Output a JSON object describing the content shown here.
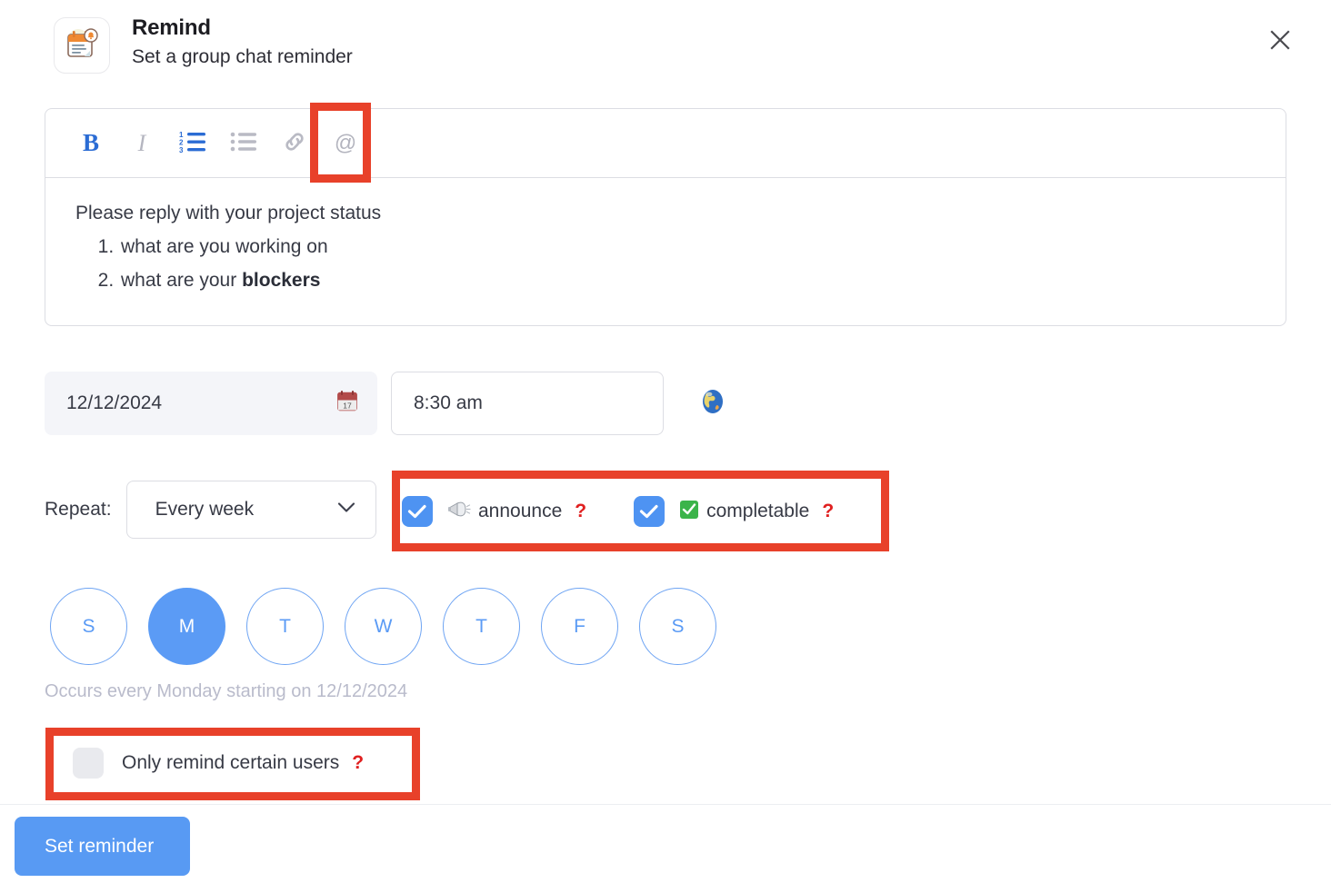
{
  "header": {
    "icon": "reminder-calendar-icon",
    "title": "Remind",
    "subtitle": "Set a group chat reminder",
    "close_label": "close-icon"
  },
  "editor": {
    "toolbar": [
      {
        "name": "bold",
        "glyph": "B",
        "active": true
      },
      {
        "name": "italic",
        "glyph": "I",
        "active": false
      },
      {
        "name": "ordered-list",
        "glyph": "ordered-list-icon",
        "active": true
      },
      {
        "name": "bullet-list",
        "glyph": "bullet-list-icon",
        "active": false
      },
      {
        "name": "link",
        "glyph": "link-icon",
        "active": false
      },
      {
        "name": "mention",
        "glyph": "@",
        "active": false
      }
    ],
    "content": {
      "paragraph": "Please reply with your project status",
      "list": [
        {
          "text": "what are you working on",
          "bold_suffix": ""
        },
        {
          "text": "what are your ",
          "bold_suffix": "blockers"
        }
      ]
    }
  },
  "schedule": {
    "date_value": "12/12/2024",
    "date_icon": "calendar-icon",
    "time_value": "8:30 am",
    "timezone_icon": "globe-icon"
  },
  "repeat": {
    "label": "Repeat:",
    "selected": "Every week",
    "chevron": "chevron-down-icon"
  },
  "options": [
    {
      "name": "announce",
      "emoji": "megaphone-icon",
      "label": "announce",
      "checked": true,
      "help": "?"
    },
    {
      "name": "completable",
      "emoji": "green-check-icon",
      "label": "completable",
      "checked": true,
      "help": "?"
    }
  ],
  "days": [
    {
      "letter": "S",
      "name": "sunday",
      "selected": false
    },
    {
      "letter": "M",
      "name": "monday",
      "selected": true
    },
    {
      "letter": "T",
      "name": "tuesday",
      "selected": false
    },
    {
      "letter": "W",
      "name": "wednesday",
      "selected": false
    },
    {
      "letter": "T",
      "name": "thursday",
      "selected": false
    },
    {
      "letter": "F",
      "name": "friday",
      "selected": false
    },
    {
      "letter": "S",
      "name": "saturday",
      "selected": false
    }
  ],
  "occurs_text": "Occurs every Monday starting on 12/12/2024",
  "only_certain_users": {
    "label": "Only remind certain users",
    "checked": false,
    "help": "?"
  },
  "footer": {
    "submit_label": "Set reminder"
  },
  "colors": {
    "accent_blue": "#589af3",
    "toolbar_active_blue": "#2b6cd4",
    "checkbox_blue": "#4e93f2",
    "day_selected": "#5b9bf5",
    "highlight_red": "#e8412a",
    "help_red": "#e02020",
    "muted_text": "#b9bbcb"
  }
}
